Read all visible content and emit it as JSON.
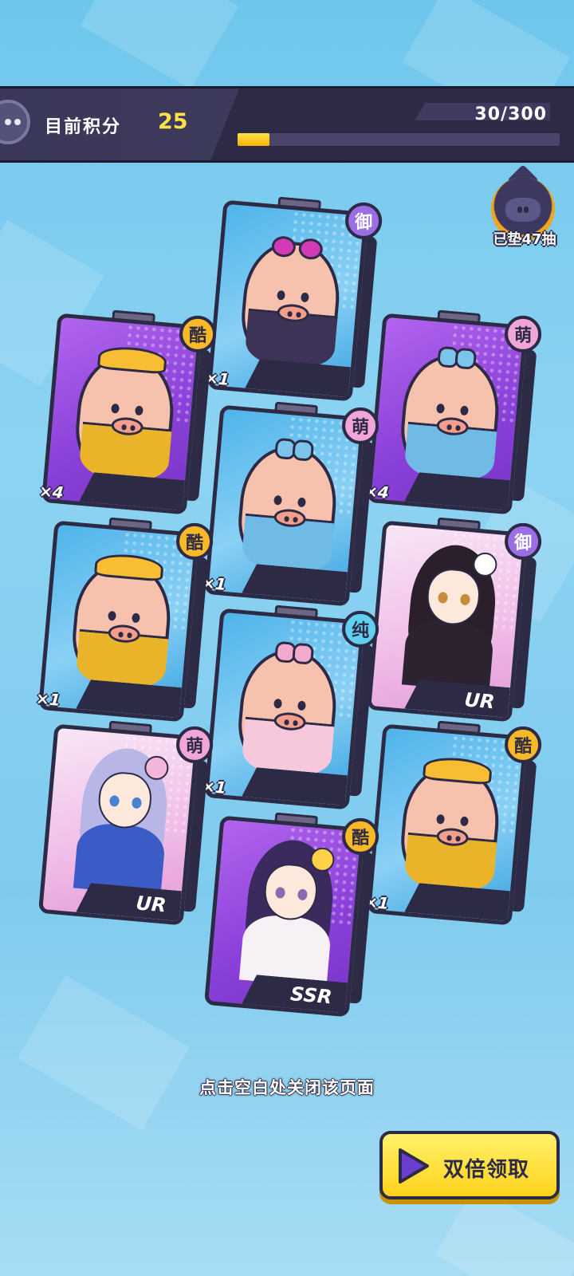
{
  "header": {
    "score_label": "目前积分",
    "score_value": "25",
    "progress_text": "30/300",
    "progress_fraction": 0.1
  },
  "pity": {
    "text": "已垫47抽"
  },
  "cards": [
    {
      "id": "c1",
      "kind": "pig",
      "frame": "blue",
      "badge": "御",
      "badge_type": "royal",
      "count": "×1",
      "variant": "sunglasses"
    },
    {
      "id": "c2",
      "kind": "pig",
      "frame": "purple",
      "badge": "酷",
      "badge_type": "cool",
      "count": "×4",
      "variant": "yellow-hat"
    },
    {
      "id": "c3",
      "kind": "pig",
      "frame": "purple",
      "badge": "萌",
      "badge_type": "cute",
      "count": "×4",
      "variant": "blue-bow"
    },
    {
      "id": "c4",
      "kind": "pig",
      "frame": "blue",
      "badge": "萌",
      "badge_type": "cute",
      "count": "×1",
      "variant": "blue-bow"
    },
    {
      "id": "c5",
      "kind": "pig",
      "frame": "blue",
      "badge": "酷",
      "badge_type": "cool",
      "count": "×1",
      "variant": "yellow-hat"
    },
    {
      "id": "c6",
      "kind": "character",
      "frame": "pink",
      "badge": "御",
      "badge_type": "royal",
      "rarity": "UR",
      "variant": "dark-hair-fan"
    },
    {
      "id": "c7",
      "kind": "pig",
      "frame": "blue",
      "badge": "纯",
      "badge_type": "pure",
      "count": "×1",
      "variant": "pink-bow"
    },
    {
      "id": "c8",
      "kind": "character",
      "frame": "pink",
      "badge": "萌",
      "badge_type": "cute",
      "rarity": "UR",
      "variant": "silver-hair-sailor"
    },
    {
      "id": "c9",
      "kind": "pig",
      "frame": "blue",
      "badge": "酷",
      "badge_type": "cool",
      "count": "×1",
      "variant": "yellow-hat"
    },
    {
      "id": "c10",
      "kind": "character",
      "frame": "purple",
      "badge": "酷",
      "badge_type": "cool",
      "rarity": "SSR",
      "variant": "purple-hair-star"
    }
  ],
  "hint": "点击空白处关闭该页面",
  "double_button": {
    "label": "双倍领取",
    "icon": "play-icon"
  },
  "colors": {
    "accent_yellow": "#ffd21c",
    "frame_dark": "#2d2a45"
  }
}
